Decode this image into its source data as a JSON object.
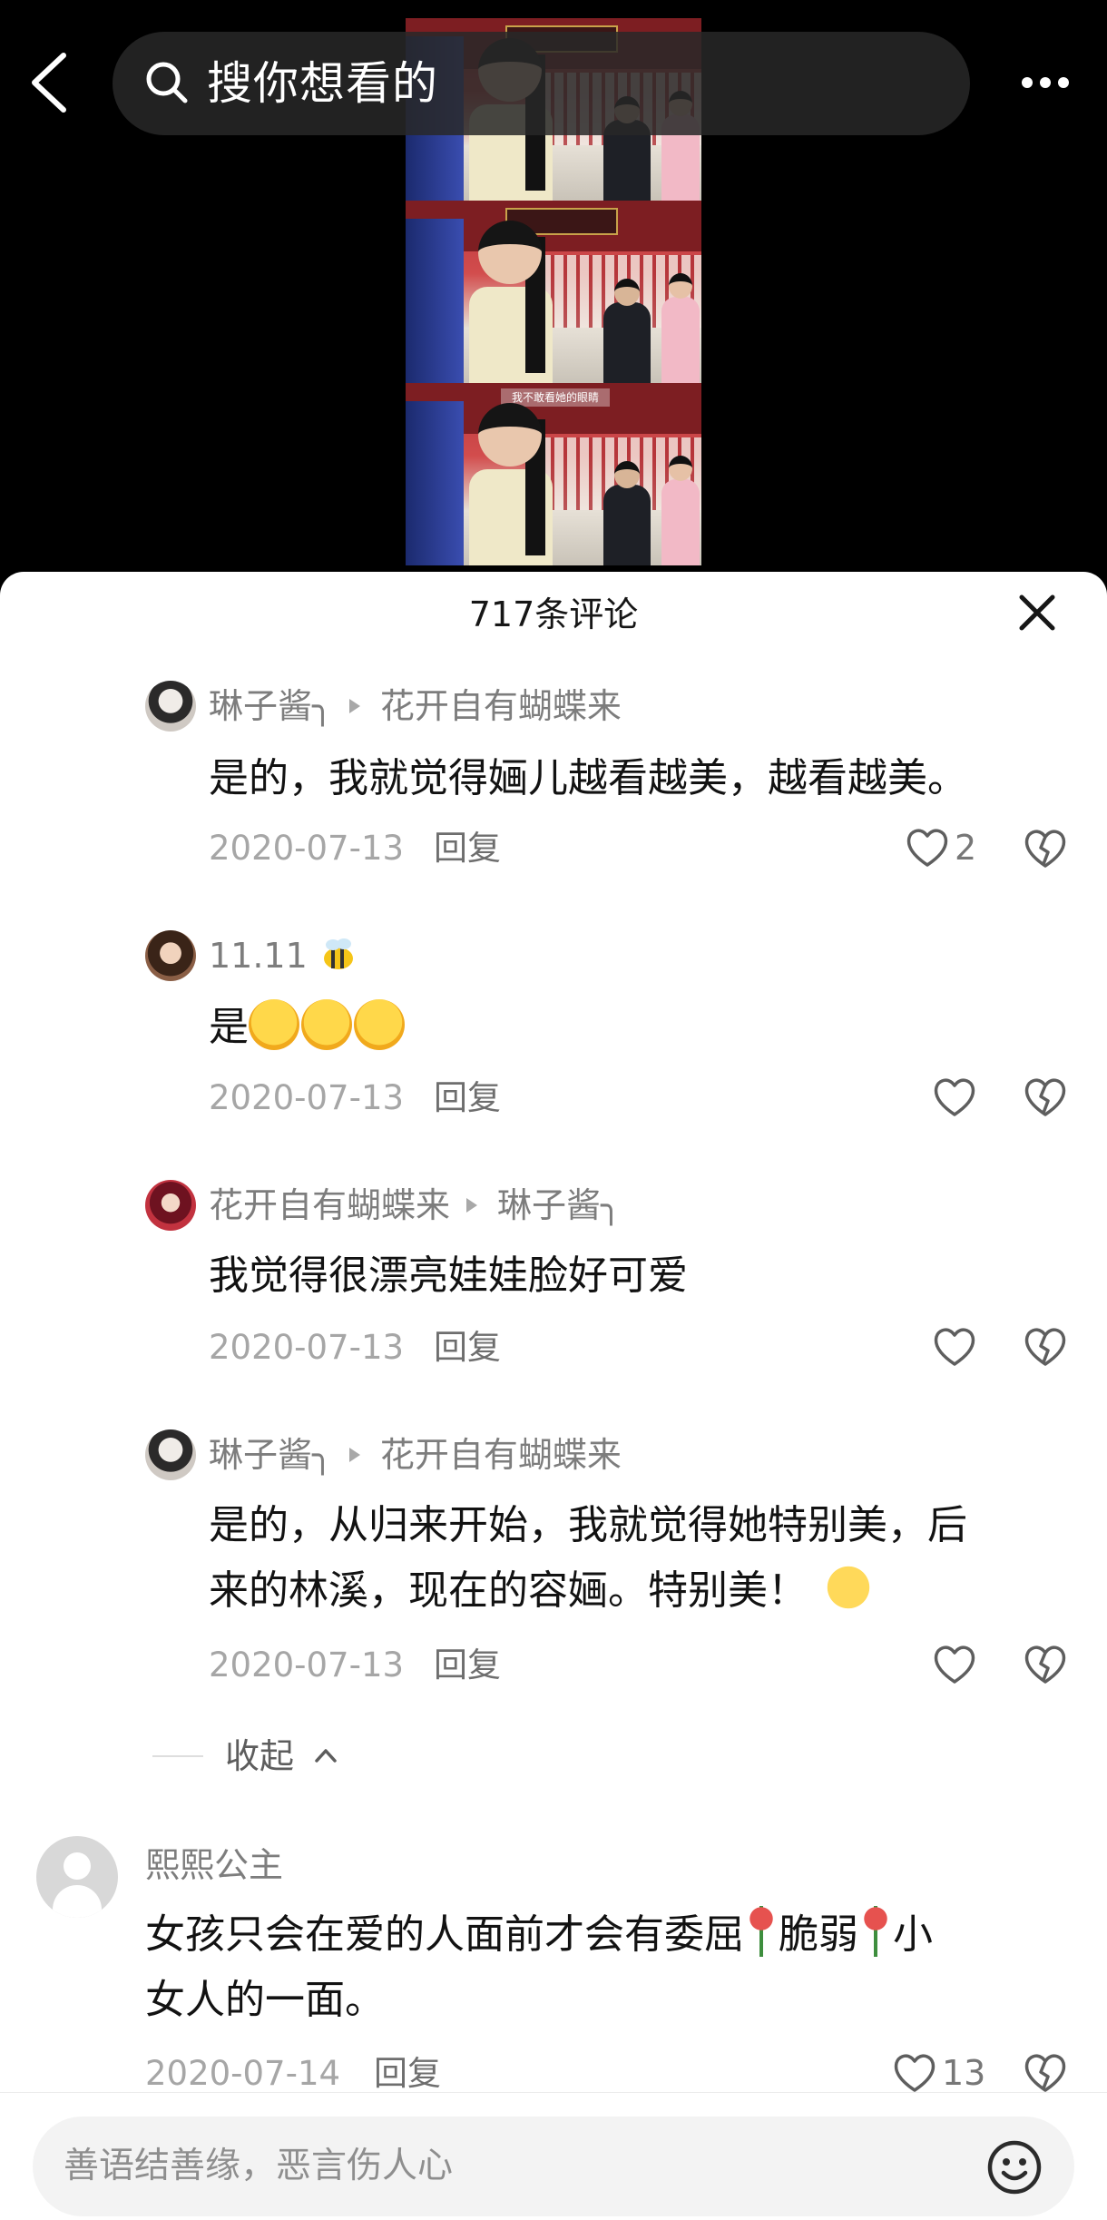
{
  "header": {
    "search_placeholder": "搜你想看的",
    "video_subtitle": "我不敢看她的眼睛"
  },
  "comments_panel": {
    "title": "717条评论",
    "comments": [
      {
        "author": "琳子酱╮",
        "reply_to": "花开自有蝴蝶来",
        "text": "是的，我就觉得婳儿越看越美，越看越美。",
        "date": "2020-07-13",
        "reply_label": "回复",
        "likes": "2"
      },
      {
        "author": "11.11",
        "text": "是",
        "date": "2020-07-13",
        "reply_label": "回复"
      },
      {
        "author": "花开自有蝴蝶来",
        "reply_to": "琳子酱╮",
        "text": "我觉得很漂亮娃娃脸好可爱",
        "date": "2020-07-13",
        "reply_label": "回复"
      },
      {
        "author": "琳子酱╮",
        "reply_to": "花开自有蝴蝶来",
        "text_line1": "是的，从归来开始，我就觉得她特别美，后",
        "text_line2": "来的林溪，现在的容婳。特别美！",
        "date": "2020-07-13",
        "reply_label": "回复"
      },
      {
        "author": "熙熙公主",
        "text_part1": "女孩只会在爱的人面前才会有委屈",
        "text_part2": "脆弱",
        "text_part3": "小",
        "text_line2": "女人的一面。",
        "date": "2020-07-14",
        "reply_label": "回复",
        "likes": "13"
      }
    ],
    "collapse_label": "收起"
  },
  "input_bar": {
    "placeholder": "善语结善缘，恶言伤人心"
  },
  "icons": {
    "back": "back-icon",
    "search": "search-icon",
    "more": "more-icon",
    "close": "close-icon",
    "like": "heart-icon",
    "dislike": "broken-heart-icon",
    "emoji": "emoji-icon"
  }
}
